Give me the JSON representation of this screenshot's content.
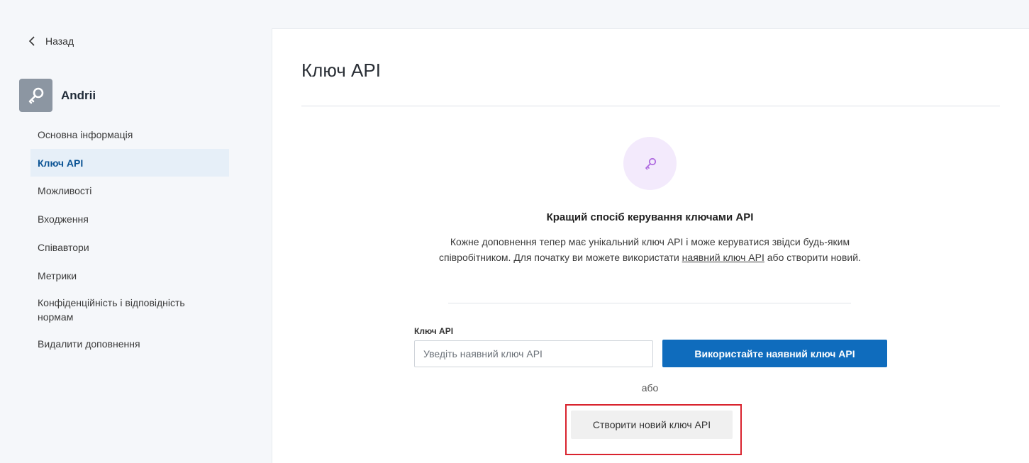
{
  "sidebar": {
    "back_label": "Назад",
    "addon_name": "Andrii",
    "items": [
      {
        "label": "Основна інформація"
      },
      {
        "label": "Ключ API"
      },
      {
        "label": "Можливості"
      },
      {
        "label": "Входження"
      },
      {
        "label": "Співавтори"
      },
      {
        "label": "Метрики"
      },
      {
        "label": "Конфіденційність і відповідність нормам"
      },
      {
        "label": "Видалити доповнення"
      }
    ],
    "active_item": "Ключ API"
  },
  "main": {
    "title": "Ключ API",
    "hero_title": "Кращий спосіб керування ключами API",
    "hero_text_before": "Кожне доповнення тепер має унікальний ключ API і може керуватися звідси будь-яким співробітником. Для початку ви можете використати ",
    "hero_link": "наявний ключ API",
    "hero_text_after": " або створити новий.",
    "field_label": "Ключ API",
    "input_placeholder": "Уведіть наявний ключ API",
    "input_value": "",
    "use_button": "Використайте наявний ключ API",
    "or_text": "або",
    "create_button": "Створити новий ключ API"
  },
  "colors": {
    "primary": "#0f6cbd",
    "active_nav_bg": "#e6eff8",
    "hero_icon_bg": "#f3eafc",
    "hero_icon": "#b06ce0",
    "highlight": "#d9232e"
  },
  "icons": {
    "back": "chevron-left-icon",
    "addon": "key-icon",
    "hero": "key-icon"
  }
}
